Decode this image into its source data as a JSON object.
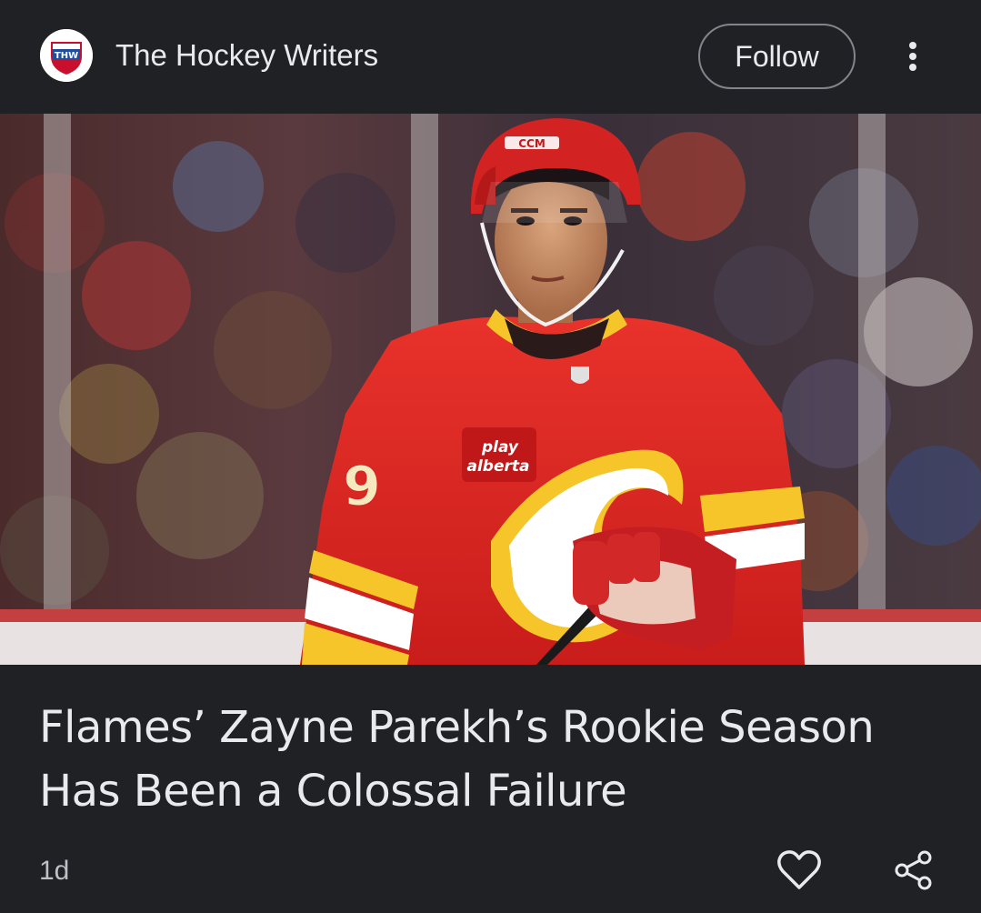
{
  "source": {
    "name": "The Hockey Writers",
    "logo_text": "THW",
    "logo_icon": "thw-shield-logo"
  },
  "header": {
    "follow_label": "Follow",
    "more_icon": "more-vertical-icon"
  },
  "hero_image": {
    "description_icon": "hockey-player-photo",
    "jersey_number": "9",
    "sponsor_line1": "play",
    "sponsor_line2": "alberta",
    "helmet_brand": "CCM"
  },
  "article": {
    "headline": "Flames’ Zayne Parekh’s Rookie Season Has Been a Colossal Failure",
    "timestamp": "1d"
  },
  "actions": {
    "like_icon": "heart-outline-icon",
    "share_icon": "share-icon"
  },
  "colors": {
    "background": "#202124",
    "text": "#e8eaed",
    "secondary_text": "#bdc1c6",
    "jersey_red": "#d6231f",
    "jersey_yellow": "#f5c52a"
  }
}
